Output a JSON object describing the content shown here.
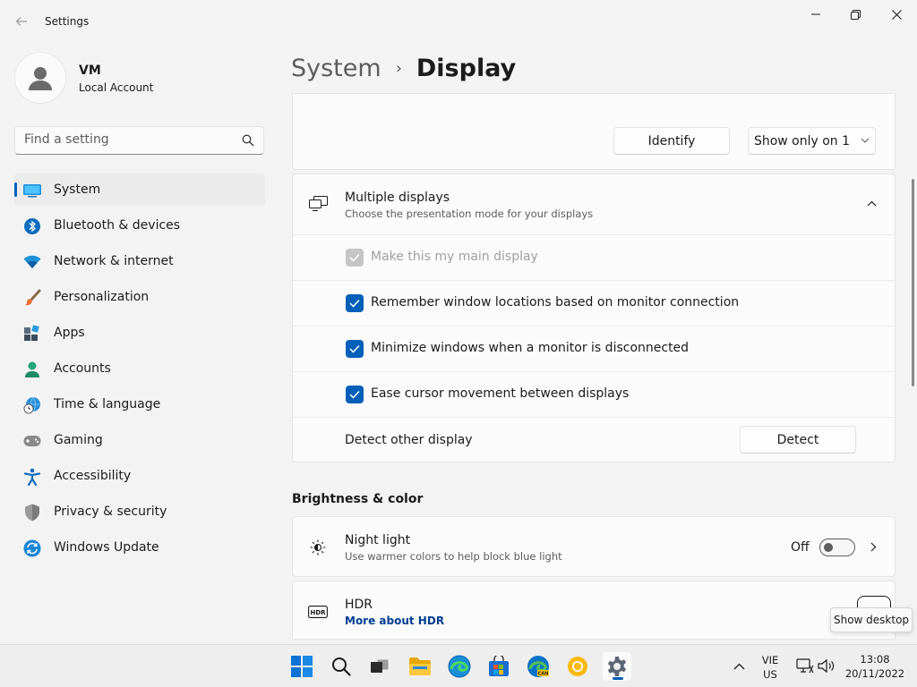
{
  "window": {
    "title": "Settings",
    "controls": [
      "minimize",
      "maximize",
      "close"
    ]
  },
  "profile": {
    "name": "VM",
    "account_type": "Local Account"
  },
  "search": {
    "placeholder": "Find a setting"
  },
  "sidebar": {
    "items": [
      {
        "label": "System",
        "icon": "system-icon",
        "active": true
      },
      {
        "label": "Bluetooth & devices",
        "icon": "bluetooth-icon"
      },
      {
        "label": "Network & internet",
        "icon": "wifi-icon"
      },
      {
        "label": "Personalization",
        "icon": "brush-icon"
      },
      {
        "label": "Apps",
        "icon": "apps-icon"
      },
      {
        "label": "Accounts",
        "icon": "person-icon"
      },
      {
        "label": "Time & language",
        "icon": "globe-clock-icon"
      },
      {
        "label": "Gaming",
        "icon": "gamepad-icon"
      },
      {
        "label": "Accessibility",
        "icon": "accessibility-icon"
      },
      {
        "label": "Privacy & security",
        "icon": "shield-icon"
      },
      {
        "label": "Windows Update",
        "icon": "update-icon"
      }
    ]
  },
  "breadcrumb": {
    "parent": "System",
    "separator": "›",
    "current": "Display"
  },
  "top_card": {
    "identify_label": "Identify",
    "display_mode_selected": "Show only on 1"
  },
  "multiple_displays": {
    "title": "Multiple displays",
    "subtitle": "Choose the presentation mode for your displays",
    "expanded": true,
    "options": [
      {
        "label": "Make this my main display",
        "checked": true,
        "disabled": true
      },
      {
        "label": "Remember window locations based on monitor connection",
        "checked": true,
        "disabled": false
      },
      {
        "label": "Minimize windows when a monitor is disconnected",
        "checked": true,
        "disabled": false
      },
      {
        "label": "Ease cursor movement between displays",
        "checked": true,
        "disabled": false
      }
    ],
    "detect_label": "Detect other display",
    "detect_button": "Detect"
  },
  "brightness_section": {
    "title": "Brightness & color"
  },
  "night_light": {
    "title": "Night light",
    "subtitle": "Use warmer colors to help block blue light",
    "state_label": "Off",
    "on": false
  },
  "hdr": {
    "title": "HDR",
    "link": "More about HDR"
  },
  "tooltip": {
    "text": "Show desktop"
  },
  "taskbar": {
    "apps": [
      "start",
      "search",
      "task-view",
      "file-explorer",
      "edge",
      "store",
      "edge-canary",
      "chrome",
      "settings"
    ],
    "active_app": "settings",
    "language": "VIE",
    "region": "US",
    "time": "13:08",
    "date": "20/11/2022"
  },
  "colors": {
    "accent": "#005fb8",
    "background": "#f3f3f3",
    "card": "#fbfbfb"
  }
}
